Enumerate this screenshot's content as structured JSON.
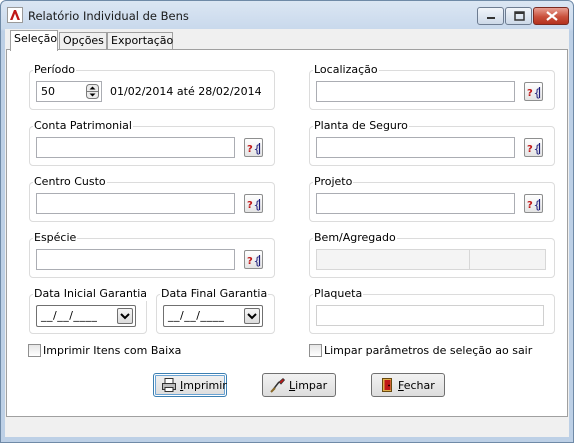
{
  "window": {
    "title": "Relatório Individual de Bens",
    "controls": {
      "minimize": "minimize-icon",
      "maximize": "maximize-icon",
      "close": "close-icon"
    }
  },
  "tabs": [
    {
      "label": "Seleção",
      "active": true
    },
    {
      "label": "Opções",
      "active": false
    },
    {
      "label": "Exportação",
      "active": false
    }
  ],
  "periodo": {
    "label": "Período",
    "value": "50",
    "range_text": "01/02/2014 até 28/02/2014"
  },
  "conta_patrimonial": {
    "label": "Conta Patrimonial",
    "value": ""
  },
  "centro_custo": {
    "label": "Centro Custo",
    "value": ""
  },
  "especie": {
    "label": "Espécie",
    "value": ""
  },
  "data_inicial_garantia": {
    "label": "Data Inicial Garantia",
    "value": "__/__/____"
  },
  "data_final_garantia": {
    "label": "Data Final Garantia",
    "value": "__/__/____"
  },
  "localizacao": {
    "label": "Localização",
    "value": ""
  },
  "planta_seguro": {
    "label": "Planta de Seguro",
    "value": ""
  },
  "projeto": {
    "label": "Projeto",
    "value": ""
  },
  "bem_agregado": {
    "label": "Bem/Agregado",
    "value_bem": "",
    "value_agregado": ""
  },
  "plaqueta": {
    "label": "Plaqueta",
    "value": ""
  },
  "checkboxes": {
    "imprimir_baixa": {
      "label": "Imprimir Itens com Baixa",
      "checked": false
    },
    "limpar_parametros": {
      "label": "Limpar parâmetros de seleção ao sair",
      "checked": false
    }
  },
  "buttons": {
    "imprimir": {
      "mnemonic": "I",
      "rest": "mprimir",
      "icon": "printer-icon"
    },
    "limpar": {
      "mnemonic": "L",
      "rest": "impar",
      "icon": "eraser-icon"
    },
    "fechar": {
      "mnemonic": "F",
      "rest": "echar",
      "icon": "door-exit-icon"
    }
  },
  "colors": {
    "accent_red": "#c01818",
    "titlebar": "#c9d9ec"
  }
}
